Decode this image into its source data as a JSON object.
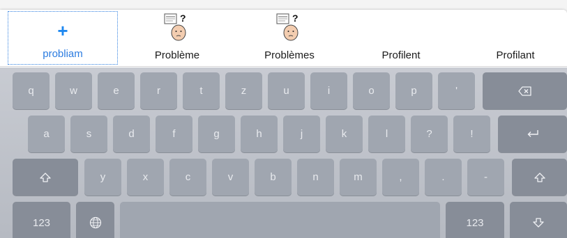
{
  "suggestions": {
    "add": {
      "label": "probliam",
      "icon": "plus-icon"
    },
    "items": [
      {
        "label": "Problème",
        "icon": "thinking-face-symbol-icon"
      },
      {
        "label": "Problèmes",
        "icon": "thinking-face-symbol-icon"
      },
      {
        "label": "Profilent"
      },
      {
        "label": "Profilant"
      }
    ],
    "accent_color": "#1e88f0"
  },
  "keyboard": {
    "row1": [
      "q",
      "w",
      "e",
      "r",
      "t",
      "z",
      "u",
      "i",
      "o",
      "p",
      "'"
    ],
    "row2": [
      "a",
      "s",
      "d",
      "f",
      "g",
      "h",
      "j",
      "k",
      "l",
      "?",
      "!"
    ],
    "row3": [
      "y",
      "x",
      "c",
      "v",
      "b",
      "n",
      "m",
      ",",
      ".",
      "-"
    ],
    "numbers_key_label": "123",
    "numbers_key_right_label": "123",
    "icons": {
      "backspace": "backspace-icon",
      "return": "return-icon",
      "shift": "shift-icon",
      "globe": "globe-icon",
      "dismiss": "dismiss-keyboard-icon"
    }
  }
}
